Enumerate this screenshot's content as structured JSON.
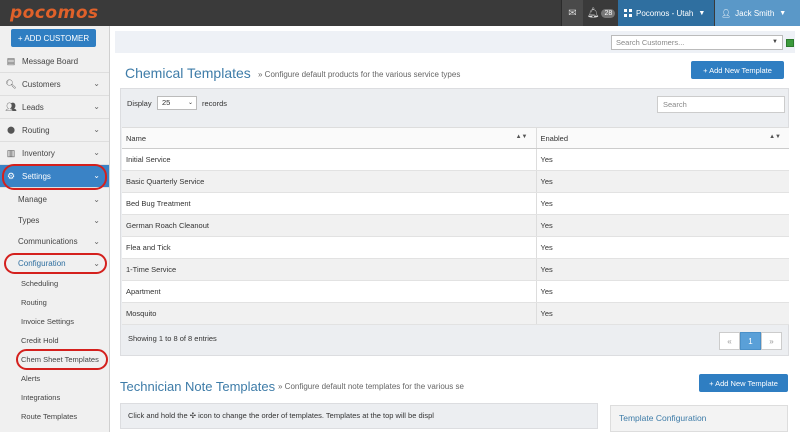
{
  "app": {
    "logo": "pocomos"
  },
  "topbar": {
    "chat_icon": "chat-icon",
    "bell_icon": "bell-icon",
    "notification_count": "28",
    "branch": "Pocomos - Utah",
    "user": "Jack Smith"
  },
  "sidebar": {
    "add_customer": "+ ADD CUSTOMER",
    "items": [
      {
        "label": "Message Board",
        "icon": "message-board-icon",
        "glyph": "▤"
      },
      {
        "label": "Customers",
        "icon": "search-icon",
        "glyph": "🔍︎"
      },
      {
        "label": "Leads",
        "icon": "users-icon",
        "glyph": "👥︎"
      },
      {
        "label": "Routing",
        "icon": "map-pin-icon",
        "glyph": "⬤"
      },
      {
        "label": "Inventory",
        "icon": "barcode-icon",
        "glyph": "▥"
      },
      {
        "label": "Settings",
        "icon": "gear-icon",
        "glyph": "⚙"
      }
    ],
    "settings_sub": [
      "Manage",
      "Types",
      "Communications",
      "Configuration"
    ],
    "config_sub": [
      "Scheduling",
      "Routing",
      "Invoice Settings",
      "Credit Hold",
      "Chem Sheet Templates",
      "Alerts",
      "Integrations",
      "Route Templates"
    ]
  },
  "search": {
    "placeholder": "Search Customers..."
  },
  "chemical": {
    "title": "Chemical Templates",
    "subtitle": "» Configure default products for the various service types",
    "add_button": "+ Add New Template",
    "display_label": "Display",
    "display_value": "25",
    "records_label": "records",
    "search_placeholder": "Search",
    "columns": [
      "Name",
      "Enabled"
    ],
    "rows": [
      {
        "name": "Initial Service",
        "enabled": "Yes"
      },
      {
        "name": "Basic Quarterly Service",
        "enabled": "Yes"
      },
      {
        "name": "Bed Bug Treatment",
        "enabled": "Yes"
      },
      {
        "name": "German Roach Cleanout",
        "enabled": "Yes"
      },
      {
        "name": "Flea and Tick",
        "enabled": "Yes"
      },
      {
        "name": "1-Time Service",
        "enabled": "Yes"
      },
      {
        "name": "Apartment",
        "enabled": "Yes"
      },
      {
        "name": "Mosquito",
        "enabled": "Yes"
      }
    ],
    "showing": "Showing 1 to 8 of 8 entries",
    "pager": {
      "prev": "«",
      "page": "1",
      "next": "»"
    }
  },
  "technician": {
    "title": "Technician Note Templates",
    "subtitle": "» Configure default note templates for the various se",
    "add_button": "+ Add New Template",
    "info": "Click and hold the ✣ icon to change the order of templates. Templates at the top will be displ",
    "config_title": "Template Configuration"
  },
  "colors": {
    "accent": "#2f7ec2",
    "highlight_circle": "#d4201d",
    "active_nav": "#3a83c6"
  }
}
